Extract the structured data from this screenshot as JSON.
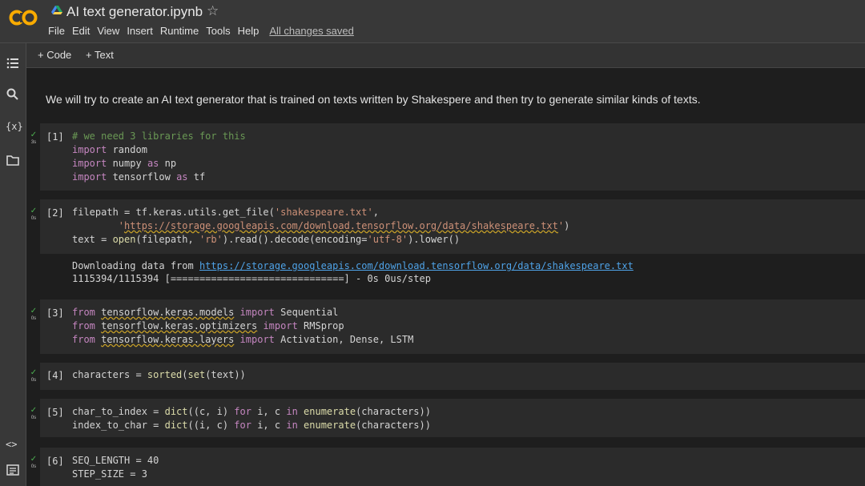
{
  "header": {
    "title": "AI text generator.ipynb",
    "menu": [
      "File",
      "Edit",
      "View",
      "Insert",
      "Runtime",
      "Tools",
      "Help"
    ],
    "save_status": "All changes saved"
  },
  "toolbar": {
    "code_label": "+ Code",
    "text_label": "+ Text"
  },
  "rail_icons": [
    "table-of-contents-icon",
    "search-icon",
    "variables-icon",
    "files-icon",
    "code-snippets-icon",
    "terminal-icon"
  ],
  "text_cell": "We will try to create an AI text generator that is trained on texts written by Shakespere and then try to generate similar kinds of texts.",
  "cells": [
    {
      "number": "[1]",
      "time": "3s",
      "lines": [
        "# we need 3 libraries for this",
        "import random",
        "import numpy as np",
        "import tensorflow as tf"
      ]
    },
    {
      "number": "[2]",
      "time": "0s",
      "lines": [
        "filepath = tf.keras.utils.get_file('shakespeare.txt',",
        "        'https://storage.googleapis.com/download.tensorflow.org/data/shakespeare.txt')",
        "text = open(filepath, 'rb').read().decode(encoding='utf-8').lower()"
      ],
      "output": [
        "Downloading data from https://storage.googleapis.com/download.tensorflow.org/data/shakespeare.txt",
        "1115394/1115394 [==============================] - 0s 0us/step"
      ]
    },
    {
      "number": "[3]",
      "time": "0s",
      "lines": [
        "from tensorflow.keras.models import Sequential",
        "from tensorflow.keras.optimizers import RMSprop",
        "from tensorflow.keras.layers import Activation, Dense, LSTM"
      ]
    },
    {
      "number": "[4]",
      "time": "0s",
      "lines": [
        "characters = sorted(set(text))"
      ]
    },
    {
      "number": "[5]",
      "time": "0s",
      "lines": [
        "char_to_index = dict((c, i) for i, c in enumerate(characters))",
        "index_to_char = dict((i, c) for i, c in enumerate(characters))"
      ]
    },
    {
      "number": "[6]",
      "time": "0s",
      "lines": [
        "SEQ_LENGTH = 40",
        "STEP_SIZE = 3"
      ]
    }
  ],
  "colors": {
    "accent_check": "#4caf50",
    "logo_orange": "#f9ab00",
    "link": "#4fa3e8"
  }
}
